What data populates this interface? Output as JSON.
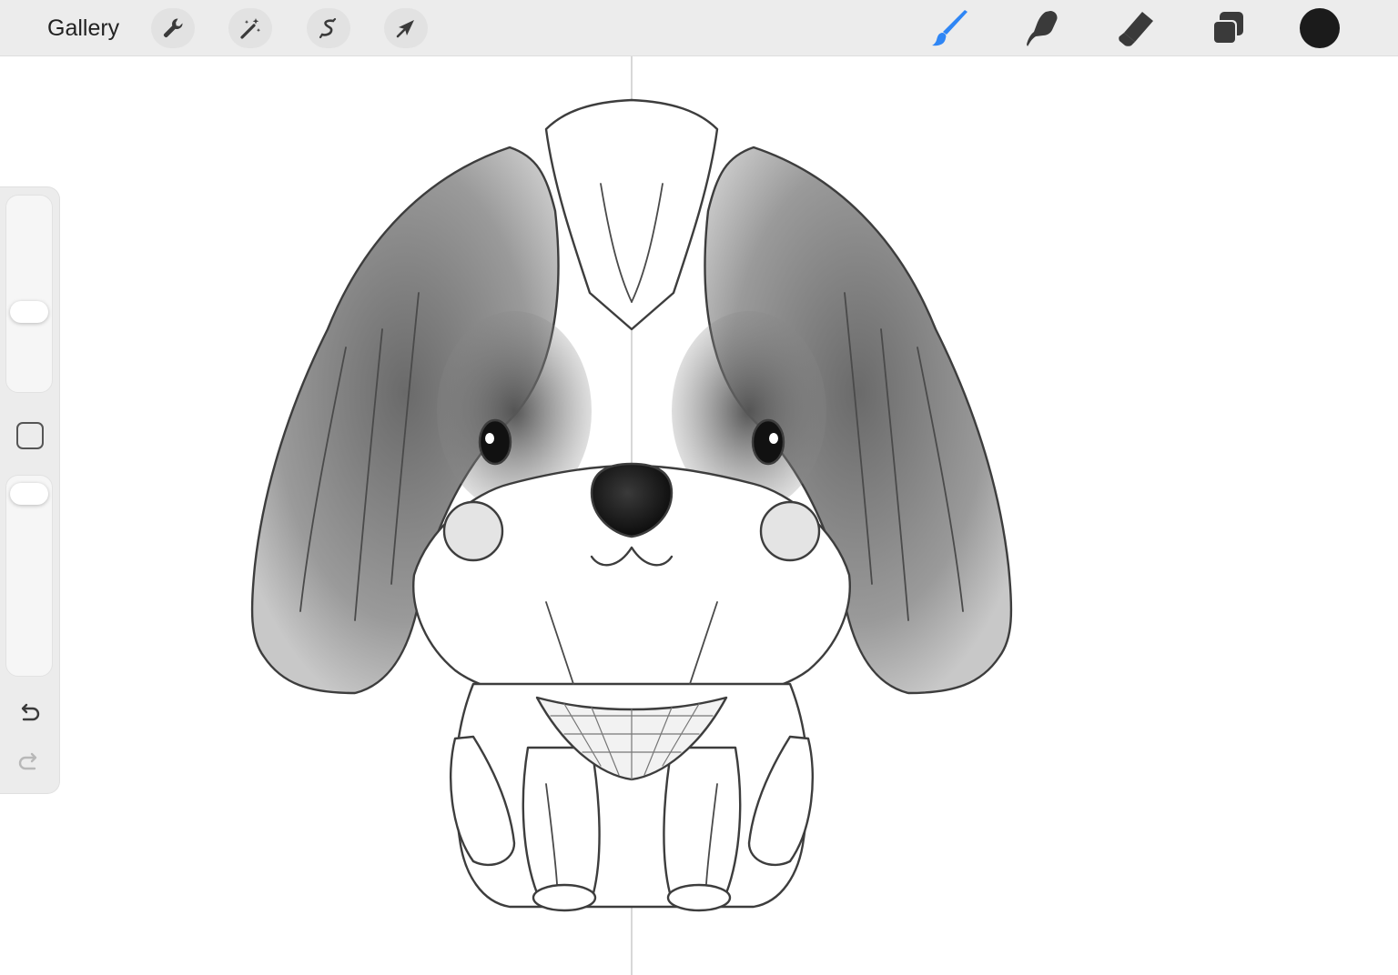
{
  "toolbar": {
    "gallery_label": "Gallery",
    "left_tools": [
      {
        "name": "actions",
        "icon": "wrench-icon"
      },
      {
        "name": "adjustments",
        "icon": "magic-wand-icon"
      },
      {
        "name": "selection",
        "icon": "selection-s-icon"
      },
      {
        "name": "transform",
        "icon": "arrow-cursor-icon"
      }
    ],
    "right_tools": [
      {
        "name": "brush",
        "icon": "paintbrush-icon",
        "active": true
      },
      {
        "name": "smudge",
        "icon": "smudge-finger-icon",
        "active": false
      },
      {
        "name": "eraser",
        "icon": "eraser-icon",
        "active": false
      },
      {
        "name": "layers",
        "icon": "layers-icon",
        "active": false
      }
    ],
    "current_color": "#1b1b1b",
    "accent_color": "#2f86f5"
  },
  "sidebar": {
    "brush_size_level": 0.6,
    "brush_opacity_level": 1.0,
    "modify_button_icon": "square-icon",
    "undo_icon": "undo-arrow-icon",
    "redo_icon": "redo-arrow-icon",
    "redo_enabled": false
  },
  "canvas": {
    "background_color": "#ffffff",
    "symmetry_guide": "vertical",
    "artwork": "pencil-sketch-shih-tzu-dog"
  }
}
